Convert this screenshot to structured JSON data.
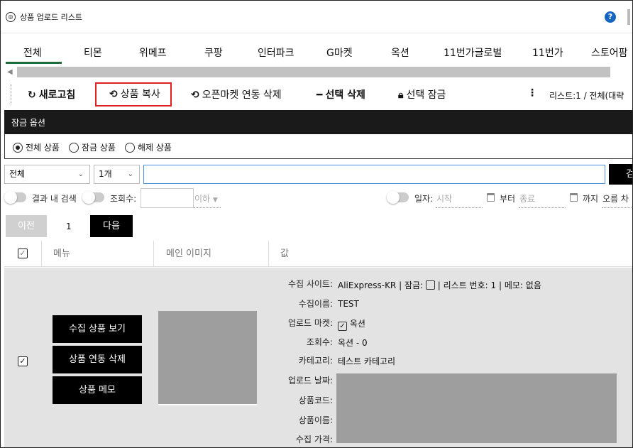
{
  "app": {
    "title": "상품 업로드 리스트",
    "help": "?"
  },
  "tabs": [
    {
      "label": "전체",
      "active": true
    },
    {
      "label": "티몬"
    },
    {
      "label": "위메프"
    },
    {
      "label": "쿠팡"
    },
    {
      "label": "인터파크"
    },
    {
      "label": "G마켓"
    },
    {
      "label": "옥션"
    },
    {
      "label": "11번가글로벌"
    },
    {
      "label": "11번가"
    },
    {
      "label": "스토어팜"
    }
  ],
  "toolbar": {
    "refresh": "새로고침",
    "copy": "상품 복사",
    "openmarket_delete": "오픈마켓 연동 삭제",
    "selected_delete": "선택 삭제",
    "selected_lock": "선택 잠금",
    "more": "⋮",
    "info": "리스트:1  /  전체(대략"
  },
  "lock": {
    "title": "잠금 옵션",
    "options": [
      "전체 상품",
      "잠금 상품",
      "해제 상품"
    ],
    "selected": "전체 상품"
  },
  "search": {
    "market_select": "전체",
    "count_select": "1개",
    "query": "",
    "button": "검"
  },
  "filters": {
    "in_result": "결과 내 검색",
    "views": "조회수:",
    "below": "이하",
    "date": "일자:",
    "start": "시작",
    "from": "부터",
    "end": "종료",
    "until": "까지",
    "sort": "오름 차"
  },
  "pagination": {
    "prev": "이전",
    "page": "1",
    "next": "다음"
  },
  "table": {
    "headers": [
      "메뉴",
      "메인 이미지",
      "값"
    ],
    "row": {
      "buttons": [
        "수집 상품 보기",
        "상품 연동 삭제",
        "상품 메모"
      ],
      "collect_site_label": "수집 사이트:",
      "collect_site": "AliExpress-KR",
      "lock_label": "| 잠금:",
      "list_no_label": "| 리스트 번호:",
      "list_no": "1",
      "memo_label": "| 메모:",
      "memo": "없음",
      "collect_name_label": "수집이름:",
      "collect_name": "TEST",
      "upload_market_label": "업로드 마켓:",
      "upload_market": "옥션",
      "views_label": "조회수:",
      "views": "옥션  -  0",
      "category_label": "카테고리:",
      "category": "테스트 카테고리",
      "upload_date_label": "업로드 날짜:",
      "product_code_label": "상품코드:",
      "product_name_label": "상품이름:",
      "collect_price_label": "수집 가격:"
    }
  },
  "colors": {
    "highlight": "#e02020",
    "tab_active": "#1d6b3a",
    "help": "#1565c0"
  }
}
